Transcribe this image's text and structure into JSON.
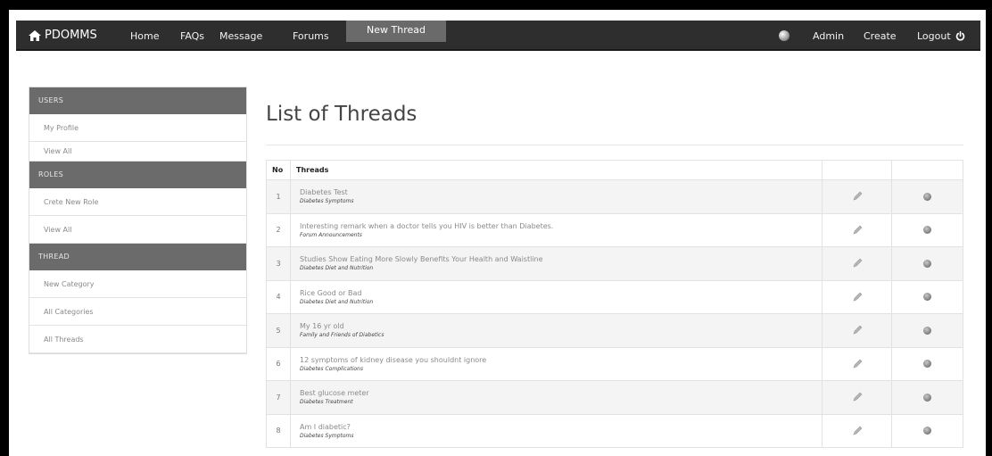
{
  "nav": {
    "brand": "PDOMMS",
    "items": [
      "Home",
      "FAQs",
      "Message",
      "Forums"
    ],
    "active": "New Thread",
    "right": {
      "admin": "Admin",
      "create": "Create",
      "logout": "Logout"
    }
  },
  "sidebar": {
    "sections": [
      {
        "heading": "USERS",
        "items": [
          "My Profile",
          "View All"
        ]
      },
      {
        "heading": "ROLES",
        "items": [
          "Crete New Role",
          "View All"
        ]
      },
      {
        "heading": "THREAD",
        "items": [
          "New Category",
          "All Categories",
          "All Threads"
        ]
      }
    ]
  },
  "main": {
    "title": "List of Threads",
    "table": {
      "headers": {
        "no": "No",
        "threads": "Threads",
        "edit": "",
        "delete": ""
      },
      "rows": [
        {
          "no": "1",
          "title": "Diabetes Test",
          "category": "Diabetes Symptoms"
        },
        {
          "no": "2",
          "title": "Interesting remark when a doctor tells you HIV is better than Diabetes.",
          "category": "Forum Announcements"
        },
        {
          "no": "3",
          "title": "Studies Show Eating More Slowly Benefits Your Health and Waistline",
          "category": "Diabetes Diet and Nutrition"
        },
        {
          "no": "4",
          "title": "Rice Good or Bad",
          "category": "Diabetes Diet and Nutrition"
        },
        {
          "no": "5",
          "title": "My 16 yr old",
          "category": "Family and Friends of Diabetics"
        },
        {
          "no": "6",
          "title": "12 symptoms of kidney disease you shouldnt ignore",
          "category": "Diabetes Complications"
        },
        {
          "no": "7",
          "title": "Best glucose meter",
          "category": "Diabetes Treatment"
        },
        {
          "no": "8",
          "title": "Am I diabetic?",
          "category": "Diabetes Symptoms"
        }
      ]
    }
  },
  "icons": {
    "brand": "home-icon",
    "globe": "globe-icon",
    "logout": "power-icon",
    "edit": "pencil-icon",
    "delete": "delete-circle-icon"
  },
  "colors": {
    "navbar": "#2e2e2e",
    "nav_active": "#6a6a6a",
    "sidebar_heading": "#6b6b6b",
    "row_alt": "#f4f4f4"
  }
}
